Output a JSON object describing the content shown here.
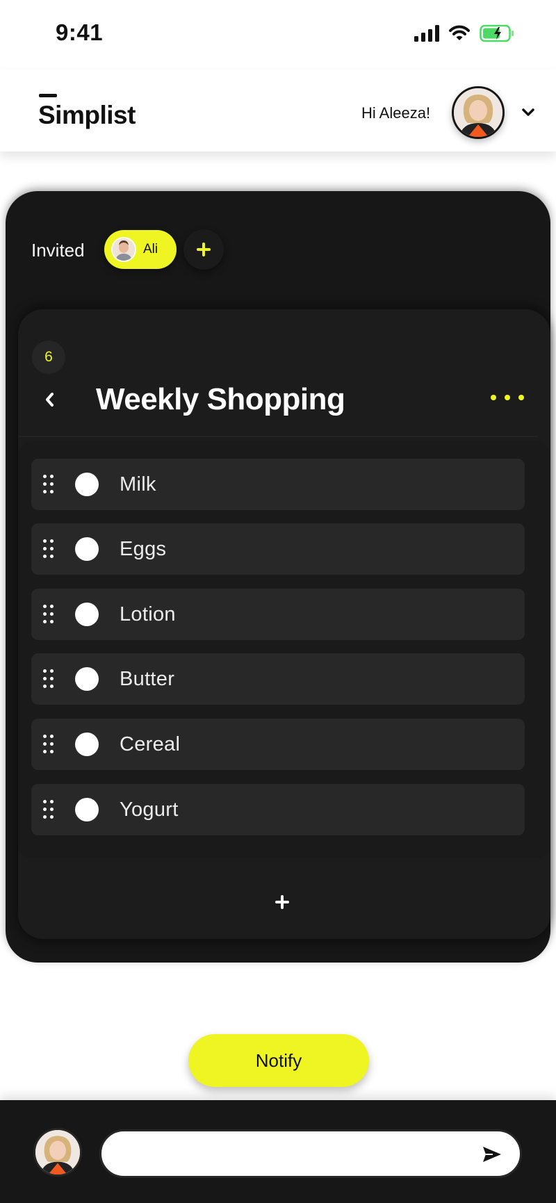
{
  "status_bar": {
    "time": "9:41"
  },
  "header": {
    "logo": "Simplist",
    "greeting": "Hi Aleeza!",
    "user_avatar": "user-avatar-aleeza"
  },
  "invited": {
    "label": "Invited",
    "members": [
      {
        "name": "Ali"
      }
    ]
  },
  "list": {
    "count": "6",
    "title": "Weekly Shopping",
    "items": [
      {
        "label": "Milk",
        "checked": false
      },
      {
        "label": "Eggs",
        "checked": false
      },
      {
        "label": "Lotion",
        "checked": false
      },
      {
        "label": "Butter",
        "checked": false
      },
      {
        "label": "Cereal",
        "checked": false
      },
      {
        "label": "Yogurt",
        "checked": false
      }
    ]
  },
  "notify": {
    "label": "Notify"
  },
  "composer": {
    "value": "",
    "placeholder": ""
  },
  "colors": {
    "accent": "#eef522",
    "dark": "#171717",
    "card": "#282828",
    "battery": "#4cd964"
  }
}
